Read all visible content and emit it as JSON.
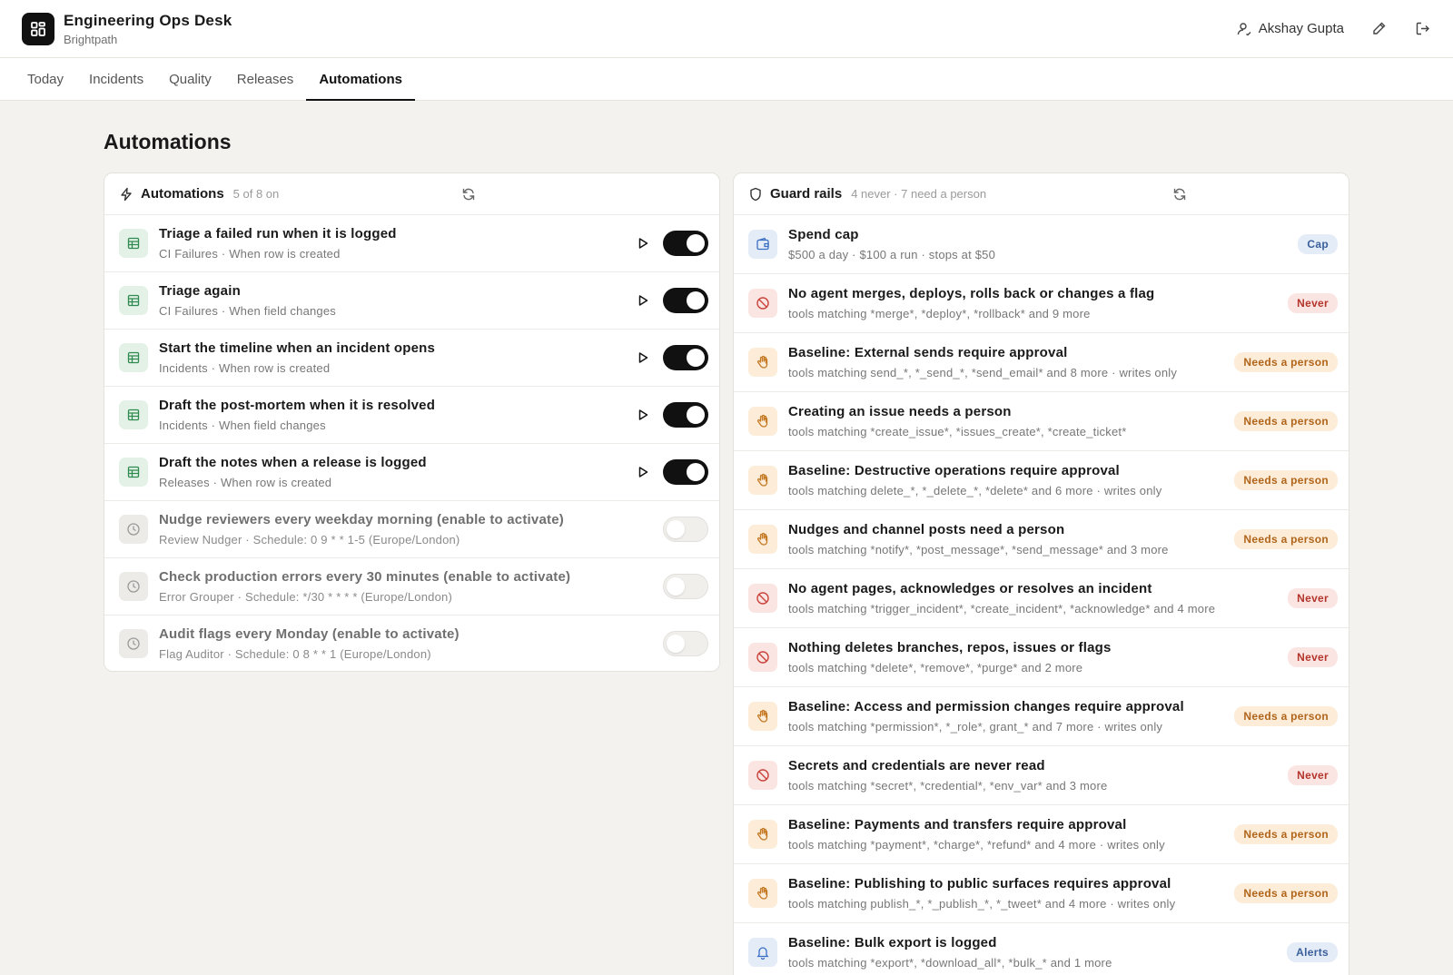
{
  "header": {
    "app_name": "Engineering Ops Desk",
    "org": "Brightpath",
    "user": "Akshay Gupta"
  },
  "tabs": [
    {
      "label": "Today",
      "active": false
    },
    {
      "label": "Incidents",
      "active": false
    },
    {
      "label": "Quality",
      "active": false
    },
    {
      "label": "Releases",
      "active": false
    },
    {
      "label": "Automations",
      "active": true
    }
  ],
  "page": {
    "title": "Automations"
  },
  "automations": {
    "title": "Automations",
    "summary": "5 of 8 on",
    "items": [
      {
        "title": "Triage a failed run when it is logged",
        "sub": "CI Failures · When row is created",
        "enabled": true,
        "icon": "table-icon"
      },
      {
        "title": "Triage again",
        "sub": "CI Failures · When field changes",
        "enabled": true,
        "icon": "table-icon"
      },
      {
        "title": "Start the timeline when an incident opens",
        "sub": "Incidents · When row is created",
        "enabled": true,
        "icon": "table-icon"
      },
      {
        "title": "Draft the post-mortem when it is resolved",
        "sub": "Incidents · When field changes",
        "enabled": true,
        "icon": "table-icon"
      },
      {
        "title": "Draft the notes when a release is logged",
        "sub": "Releases · When row is created",
        "enabled": true,
        "icon": "table-icon"
      },
      {
        "title": "Nudge reviewers every weekday morning (enable to activate)",
        "sub": "Review Nudger · Schedule: 0 9 * * 1-5 (Europe/London)",
        "enabled": false,
        "icon": "clock-icon"
      },
      {
        "title": "Check production errors every 30 minutes (enable to activate)",
        "sub": "Error Grouper · Schedule: */30 * * * * (Europe/London)",
        "enabled": false,
        "icon": "clock-icon"
      },
      {
        "title": "Audit flags every Monday (enable to activate)",
        "sub": "Flag Auditor · Schedule: 0 8 * * 1 (Europe/London)",
        "enabled": false,
        "icon": "clock-icon"
      }
    ]
  },
  "guardrails": {
    "title": "Guard rails",
    "summary": "4 never · 7 need a person",
    "items": [
      {
        "title": "Spend cap",
        "sub": "$500 a day · $100 a run · stops at $50",
        "badge": "Cap",
        "kind": "cap"
      },
      {
        "title": "No agent merges, deploys, rolls back or changes a flag",
        "sub": "tools matching *merge*, *deploy*, *rollback* and 9 more",
        "badge": "Never",
        "kind": "never"
      },
      {
        "title": "Baseline: External sends require approval",
        "sub": "tools matching send_*, *_send_*, *send_email* and 8 more · writes only",
        "badge": "Needs a person",
        "kind": "person"
      },
      {
        "title": "Creating an issue needs a person",
        "sub": "tools matching *create_issue*, *issues_create*, *create_ticket*",
        "badge": "Needs a person",
        "kind": "person"
      },
      {
        "title": "Baseline: Destructive operations require approval",
        "sub": "tools matching delete_*, *_delete_*, *delete* and 6 more · writes only",
        "badge": "Needs a person",
        "kind": "person"
      },
      {
        "title": "Nudges and channel posts need a person",
        "sub": "tools matching *notify*, *post_message*, *send_message* and 3 more",
        "badge": "Needs a person",
        "kind": "person"
      },
      {
        "title": "No agent pages, acknowledges or resolves an incident",
        "sub": "tools matching *trigger_incident*, *create_incident*, *acknowledge* and 4 more",
        "badge": "Never",
        "kind": "never"
      },
      {
        "title": "Nothing deletes branches, repos, issues or flags",
        "sub": "tools matching *delete*, *remove*, *purge* and 2 more",
        "badge": "Never",
        "kind": "never"
      },
      {
        "title": "Baseline: Access and permission changes require approval",
        "sub": "tools matching *permission*, *_role*, grant_* and 7 more · writes only",
        "badge": "Needs a person",
        "kind": "person"
      },
      {
        "title": "Secrets and credentials are never read",
        "sub": "tools matching *secret*, *credential*, *env_var* and 3 more",
        "badge": "Never",
        "kind": "never"
      },
      {
        "title": "Baseline: Payments and transfers require approval",
        "sub": "tools matching *payment*, *charge*, *refund* and 4 more · writes only",
        "badge": "Needs a person",
        "kind": "person"
      },
      {
        "title": "Baseline: Publishing to public surfaces requires approval",
        "sub": "tools matching publish_*, *_publish_*, *_tweet* and 4 more · writes only",
        "badge": "Needs a person",
        "kind": "person"
      },
      {
        "title": "Baseline: Bulk export is logged",
        "sub": "tools matching *export*, *download_all*, *bulk_* and 1 more",
        "badge": "Alerts",
        "kind": "alerts"
      }
    ]
  },
  "colors": {
    "accent": "#111111",
    "background": "#f3f2ef",
    "never": "#b4352c",
    "person": "#b0651a",
    "info": "#3a5f9a"
  }
}
